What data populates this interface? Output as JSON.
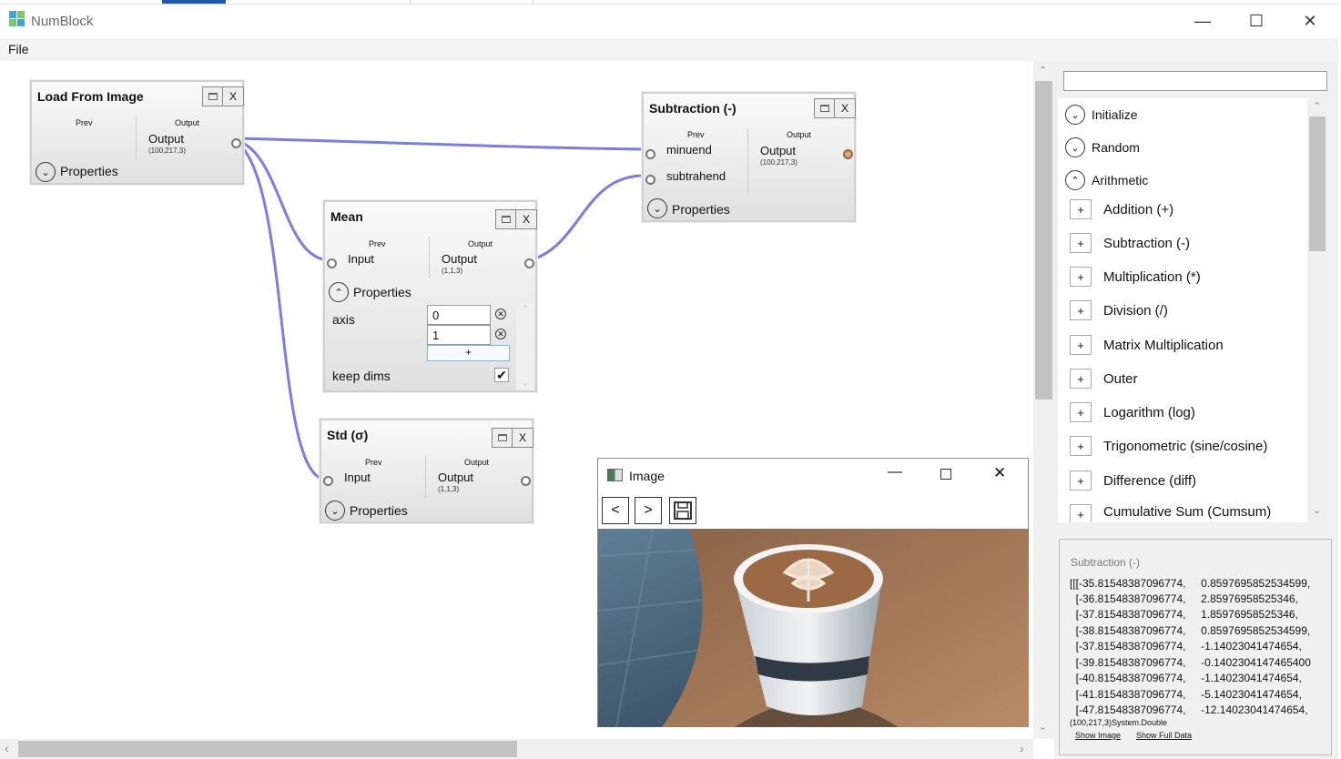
{
  "window": {
    "title": "NumBlock",
    "minimize": "—",
    "maximize": "☐",
    "close": "✕"
  },
  "menu": {
    "file": "File"
  },
  "nodes": {
    "load": {
      "title": "Load From Image",
      "prev": "Prev",
      "output_hdr": "Output",
      "output": "Output",
      "shape": "(100,217,3)",
      "properties": "Properties",
      "min": "",
      "close": "X"
    },
    "subtraction": {
      "title": "Subtraction (-)",
      "prev": "Prev",
      "output_hdr": "Output",
      "in1": "minuend",
      "in2": "subtrahend",
      "output": "Output",
      "shape": "(100,217,3)",
      "properties": "Properties",
      "close": "X"
    },
    "mean": {
      "title": "Mean",
      "prev": "Prev",
      "output_hdr": "Output",
      "input": "Input",
      "output": "Output",
      "shape": "(1,1,3)",
      "properties": "Properties",
      "close": "X",
      "axis_label": "axis",
      "axis_values": [
        "0",
        "1"
      ],
      "add": "+",
      "keepdims_label": "keep dims",
      "keepdims": true
    },
    "std": {
      "title": "Std (σ)",
      "prev": "Prev",
      "output_hdr": "Output",
      "input": "Input",
      "output": "Output",
      "shape": "(1,1,3)",
      "properties": "Properties",
      "close": "X"
    }
  },
  "palette": {
    "categories": [
      {
        "label": "Initialize",
        "expanded": false
      },
      {
        "label": "Random",
        "expanded": false
      },
      {
        "label": "Arithmetic",
        "expanded": true
      }
    ],
    "operations": [
      "Addition (+)",
      "Subtraction (-)",
      "Multiplication (*)",
      "Division (/)",
      "Matrix Multiplication",
      "Outer",
      "Logarithm (log)",
      "Trigonometric (sine/cosine)",
      "Difference (diff)",
      "Cumulative Sum (Cumsum)"
    ],
    "add_symbol": "+"
  },
  "output_panel": {
    "title": "Subtraction (-)",
    "rows": [
      "[[[-35.81548387096774,     0.8597695852534599,",
      "  [-36.81548387096774,     2.85976958525346,",
      "  [-37.81548387096774,     1.85976958525346,",
      "  [-38.81548387096774,     0.8597695852534599,",
      "  [-37.81548387096774,     -1.14023041474654,",
      "  [-39.81548387096774,     -0.1402304147465400",
      "  [-40.81548387096774,     -1.14023041474654,",
      "  [-41.81548387096774,     -5.14023041474654,",
      "  [-47.81548387096774,     -12.14023041474654,"
    ],
    "dtype": "(100,217,3)System.Double",
    "show_image": "Show Image",
    "show_full": "Show Full Data"
  },
  "image_window": {
    "title": "Image",
    "prev": "<",
    "next": ">",
    "save": "save-icon"
  }
}
